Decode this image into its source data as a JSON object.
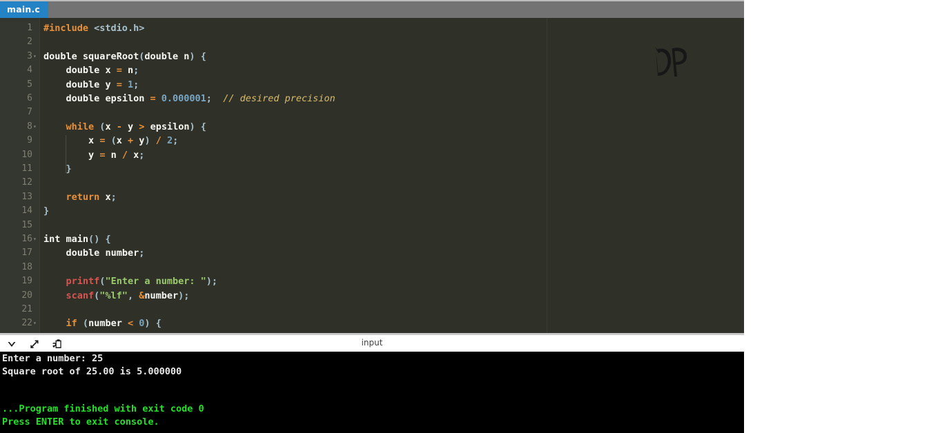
{
  "window": {
    "accent_color": "#2383c4",
    "editor_bg": "#2f3129",
    "gutter_bg": "#343630",
    "console_bg": "#000000",
    "console_text_color": "#e9e9e9",
    "console_status_color": "#24e02a"
  },
  "tabs": [
    {
      "label": "main.c",
      "active": true
    }
  ],
  "watermark": {
    "label": "DP"
  },
  "editor": {
    "first_visible_line": 1,
    "last_visible_line": 22,
    "fold_lines": [
      3,
      8,
      16,
      22
    ],
    "lines": [
      {
        "n": 1,
        "text": "#include <stdio.h>"
      },
      {
        "n": 2,
        "text": ""
      },
      {
        "n": 3,
        "text": "double squareRoot(double n) {"
      },
      {
        "n": 4,
        "text": "    double x = n;"
      },
      {
        "n": 5,
        "text": "    double y = 1;"
      },
      {
        "n": 6,
        "text": "    double epsilon = 0.000001;  // desired precision"
      },
      {
        "n": 7,
        "text": ""
      },
      {
        "n": 8,
        "text": "    while (x - y > epsilon) {"
      },
      {
        "n": 9,
        "text": "        x = (x + y) / 2;"
      },
      {
        "n": 10,
        "text": "        y = n / x;"
      },
      {
        "n": 11,
        "text": "    }"
      },
      {
        "n": 12,
        "text": ""
      },
      {
        "n": 13,
        "text": "    return x;"
      },
      {
        "n": 14,
        "text": "}"
      },
      {
        "n": 15,
        "text": ""
      },
      {
        "n": 16,
        "text": "int main() {"
      },
      {
        "n": 17,
        "text": "    double number;"
      },
      {
        "n": 18,
        "text": ""
      },
      {
        "n": 19,
        "text": "    printf(\"Enter a number: \");"
      },
      {
        "n": 20,
        "text": "    scanf(\"%lf\", &number);"
      },
      {
        "n": 21,
        "text": ""
      },
      {
        "n": 22,
        "text": "    if (number < 0) {"
      }
    ]
  },
  "console": {
    "title": "input",
    "tools": [
      {
        "name": "collapse-icon",
        "label": "Collapse"
      },
      {
        "name": "expand-icon",
        "label": "Expand"
      },
      {
        "name": "copy-clipboard-icon",
        "label": "Copy"
      }
    ],
    "output_lines": [
      {
        "text": "Enter a number: 25",
        "color": "white"
      },
      {
        "text": "Square root of 25.00 is 5.000000",
        "color": "white"
      },
      {
        "text": "",
        "color": "white"
      },
      {
        "text": "...Program finished with exit code 0",
        "color": "green"
      },
      {
        "text": "Press ENTER to exit console.",
        "color": "green"
      }
    ]
  }
}
